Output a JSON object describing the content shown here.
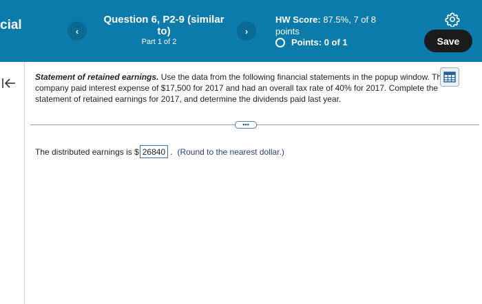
{
  "header": {
    "app_title": "cial",
    "question_title": "Question 6, P2-9 (similar to)",
    "part": "Part 1 of 2",
    "hw_score_label": "HW Score:",
    "hw_score_value": "87.5%, 7 of 8 points",
    "points_label": "Points:",
    "points_value": "0 of 1",
    "save_label": "Save",
    "prev_label": "‹",
    "next_label": "›"
  },
  "problem": {
    "lead": "Statement of retained earnings.",
    "text": " Use the data from the following financial statements in the popup window. The company paid interest expense of $17,500 for 2017 and had an overall tax rate of 40% for 2017. Complete the statement of retained earnings for 2017, and determine the dividends paid last year."
  },
  "more_label": "•••",
  "answer": {
    "prefix": "The distributed earnings is $",
    "value": "26840",
    "suffix": ".",
    "hint": "(Round to the nearest dollar.)"
  },
  "colors": {
    "header_bg": "#0b7bab",
    "save_bg": "#1c1c1c",
    "hint": "#2a3e8c"
  }
}
